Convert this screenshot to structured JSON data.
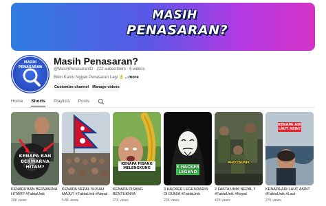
{
  "banner": {
    "line1": "MASIH",
    "line2": "PENASARAN?"
  },
  "channel": {
    "name": "Masih Penasaran?",
    "handle": "@MasihPenasaranID",
    "subscribers": "222 subscribers",
    "videos": "6 videos",
    "description": "Bikin Kamu Nggak Penasaran Lagi 👌",
    "more_label": "...more",
    "customize_label": "Customize channel",
    "manage_label": "Manage videos"
  },
  "tabs": [
    {
      "label": "Home",
      "active": false
    },
    {
      "label": "Shorts",
      "active": true
    },
    {
      "label": "Playlists",
      "active": false
    },
    {
      "label": "Posts",
      "active": false
    }
  ],
  "shorts": [
    {
      "title": "KENAPA BAN BERWARNA HITAM? #FaktaUnik",
      "views": "29K views",
      "caption": "KENAPA BAN BERWARNA HITAM?"
    },
    {
      "title": "KENAPA NEPAL SUSAH MAJU? #FaktaUnik #Nepal",
      "views": "5.8K views",
      "caption": ""
    },
    {
      "title": "KENAPA PISANG BENTUKNYA MELENGKUNG?",
      "views": "27K views",
      "caption": "KENAPA PISANG MELENGKUNG"
    },
    {
      "title": "3 HACKER LEGENDARIS DI DUNIA #FaktaUnik",
      "views": "22K views",
      "caption": "3 HACKER LEGEND"
    },
    {
      "title": "2 FAKTA UNIK NEPAL !! #FaktaUnik #Nepal",
      "views": "42K views",
      "caption": "#FAKTAUNIK"
    },
    {
      "title": "KENAPA AIR LAUT ASIN? #FaktaUnik #Laut",
      "views": "27K views",
      "caption": "KENAPA AIR LAUT ASIN?"
    }
  ],
  "colors": {
    "accent_green": "#35c44a",
    "accent_red": "#e8202a",
    "text_secondary": "#606060"
  }
}
